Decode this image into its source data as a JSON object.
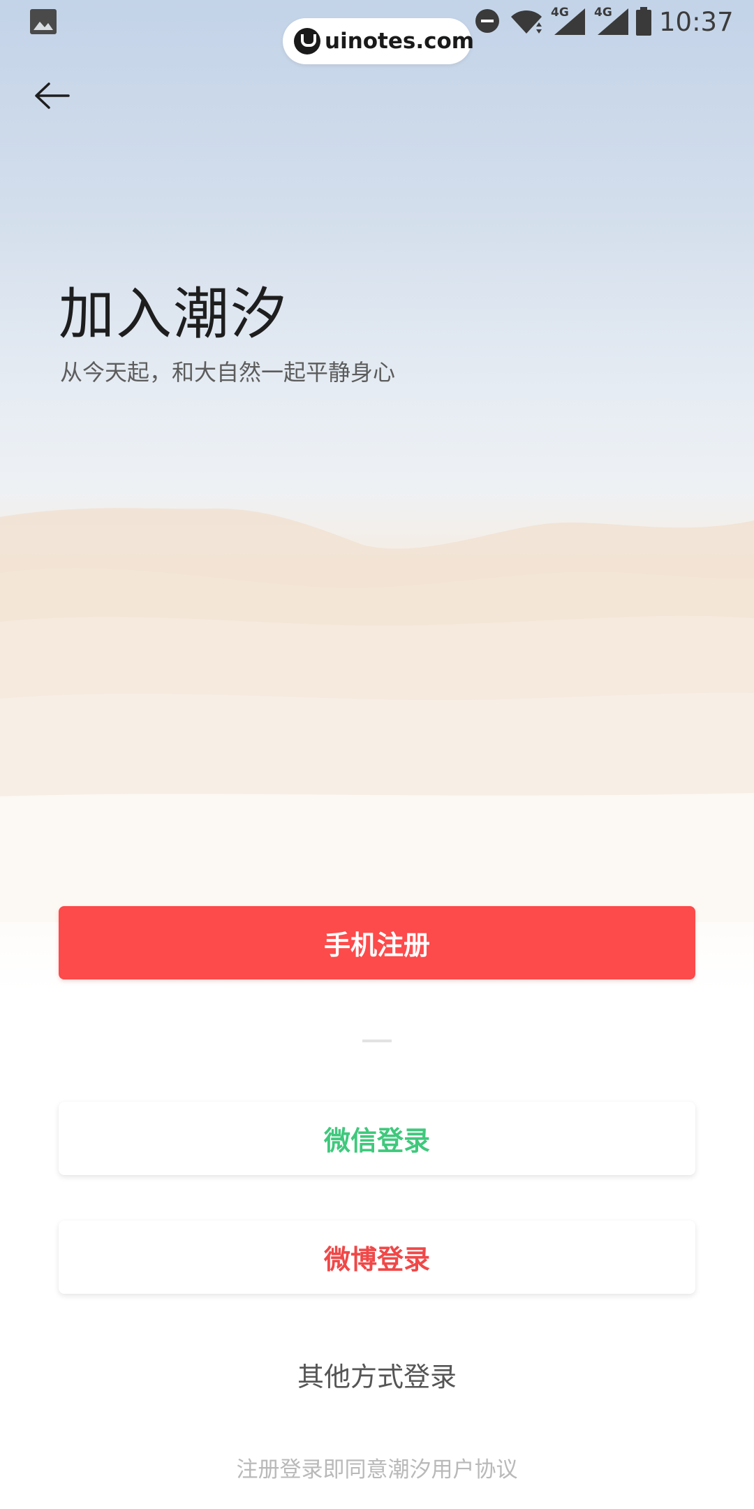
{
  "status_bar": {
    "time": "10:37",
    "network_1": "4G",
    "network_2": "4G",
    "icons": [
      "gallery-icon",
      "do-not-disturb-icon",
      "wifi-icon",
      "signal-icon",
      "signal-icon",
      "battery-icon"
    ]
  },
  "watermark": {
    "text": "uinotes.com"
  },
  "header": {
    "back_icon": "arrow-left-icon"
  },
  "hero": {
    "title": "加入潮汐",
    "subtitle": "从今天起，和大自然一起平静身心"
  },
  "actions": {
    "phone_register": "手机注册",
    "wechat_login": "微信登录",
    "weibo_login": "微博登录",
    "other_login": "其他方式登录",
    "agreement": "注册登录即同意潮汐用户协议"
  },
  "colors": {
    "primary": "#fd4a4a",
    "wechat": "#3fc87c",
    "weibo": "#f04848"
  }
}
